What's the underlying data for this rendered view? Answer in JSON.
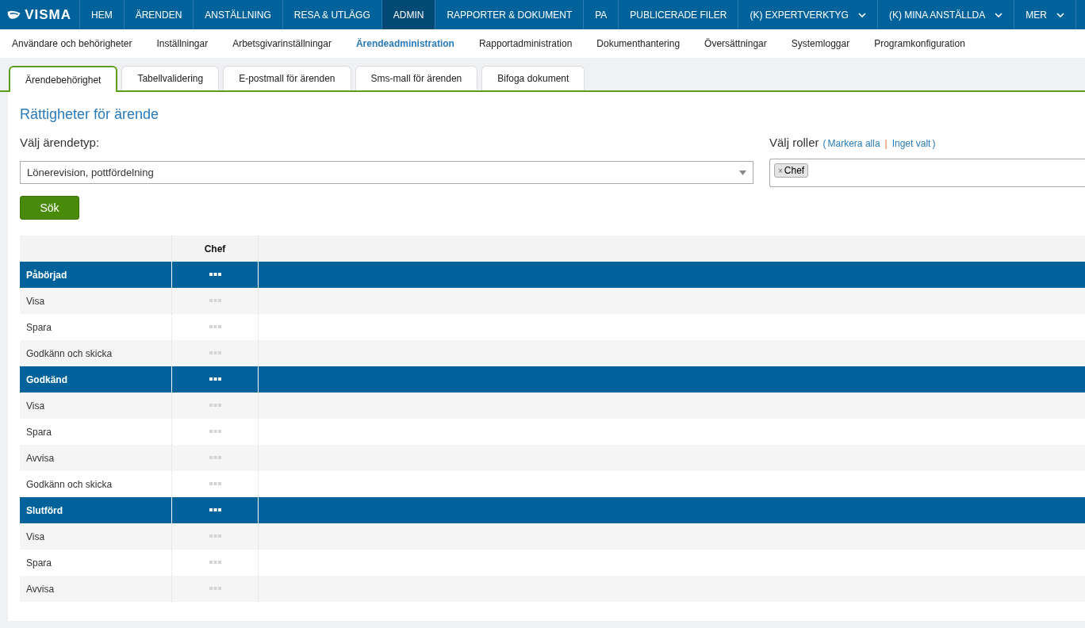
{
  "logo": {
    "text": "VISMA"
  },
  "nav": [
    {
      "label": "HEM",
      "selected": false,
      "has_menu": false
    },
    {
      "label": "ÄRENDEN",
      "selected": false,
      "has_menu": false
    },
    {
      "label": "ANSTÄLLNING",
      "selected": false,
      "has_menu": false
    },
    {
      "label": "RESA & UTLÄGG",
      "selected": false,
      "has_menu": false
    },
    {
      "label": "ADMIN",
      "selected": true,
      "has_menu": false
    },
    {
      "label": "RAPPORTER & DOKUMENT",
      "selected": false,
      "has_menu": false
    },
    {
      "label": "PA",
      "selected": false,
      "has_menu": false
    },
    {
      "label": "PUBLICERADE FILER",
      "selected": false,
      "has_menu": false
    },
    {
      "label": "(K) EXPERTVERKTYG",
      "selected": false,
      "has_menu": true
    },
    {
      "label": "(K) MINA ANSTÄLLDA",
      "selected": false,
      "has_menu": true
    },
    {
      "label": "MER",
      "selected": false,
      "has_menu": true
    }
  ],
  "subnav": [
    {
      "label": "Användare och behörigheter",
      "selected": false
    },
    {
      "label": "Inställningar",
      "selected": false
    },
    {
      "label": "Arbetsgivarinställningar",
      "selected": false
    },
    {
      "label": "Ärendeadministration",
      "selected": true
    },
    {
      "label": "Rapportadministration",
      "selected": false
    },
    {
      "label": "Dokumenthantering",
      "selected": false
    },
    {
      "label": "Översättningar",
      "selected": false
    },
    {
      "label": "Systemloggar",
      "selected": false
    },
    {
      "label": "Programkonfiguration",
      "selected": false
    }
  ],
  "tabs": [
    {
      "label": "Ärendebehörighet",
      "selected": true
    },
    {
      "label": "Tabellvalidering",
      "selected": false
    },
    {
      "label": "E-postmall för ärenden",
      "selected": false
    },
    {
      "label": "Sms-mall för ärenden",
      "selected": false
    },
    {
      "label": "Bifoga dokument",
      "selected": false
    }
  ],
  "heading": "Rättigheter för ärende",
  "type_select": {
    "label": "Välj ärendetyp:",
    "value": "Lönerevision, pottfördelning"
  },
  "roles": {
    "label": "Välj roller",
    "open_paren": "(",
    "select_all": "Markera alla",
    "separator": "|",
    "select_none": "Inget valt",
    "close_paren": ")",
    "tags": [
      {
        "label": "Chef",
        "remove": "×"
      }
    ]
  },
  "search_button": "Sök",
  "table": {
    "columns": [
      "Chef"
    ],
    "groups": [
      {
        "label": "Påbörjad",
        "children": [
          {
            "label": "Visa"
          },
          {
            "label": "Spara"
          },
          {
            "label": "Godkänn och skicka"
          }
        ]
      },
      {
        "label": "Godkänd",
        "children": [
          {
            "label": "Visa"
          },
          {
            "label": "Spara"
          },
          {
            "label": "Avvisa"
          },
          {
            "label": "Godkänn och skicka"
          }
        ]
      },
      {
        "label": "Slutförd",
        "children": [
          {
            "label": "Visa"
          },
          {
            "label": "Spara"
          },
          {
            "label": "Avvisa"
          }
        ]
      }
    ]
  }
}
